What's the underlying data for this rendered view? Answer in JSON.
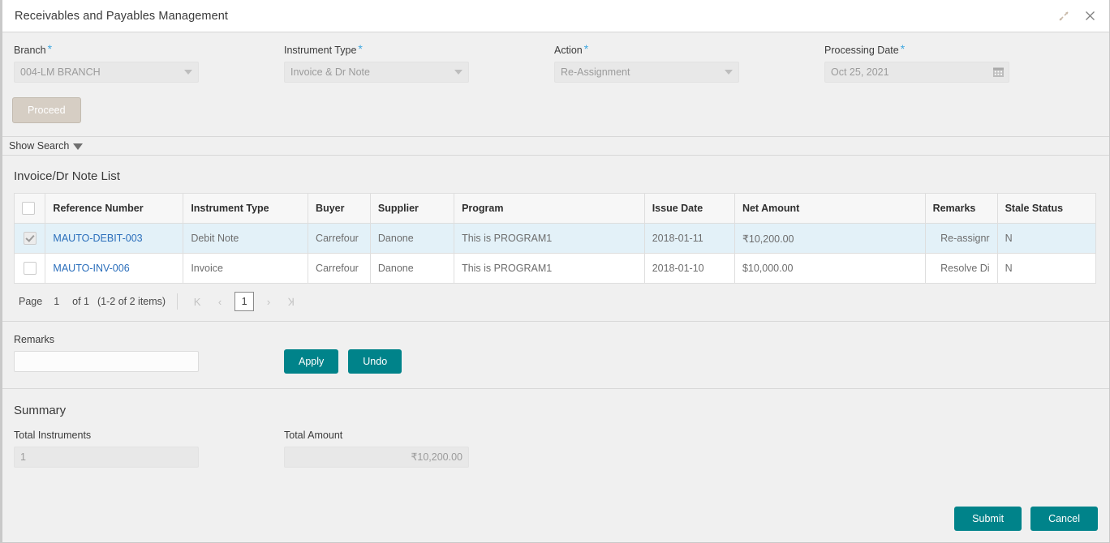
{
  "window": {
    "title": "Receivables and Payables Management",
    "controls": [
      {
        "name": "minimize-icon",
        "label": "minimize"
      },
      {
        "name": "close-icon",
        "label": "close"
      }
    ]
  },
  "form": {
    "fields": [
      {
        "label": "Branch",
        "required": "*",
        "value": "004-LM BRANCH",
        "type": "select",
        "name": "branch"
      },
      {
        "label": "Instrument Type",
        "required": "*",
        "value": "Invoice & Dr Note",
        "type": "select",
        "name": "instrument-type"
      },
      {
        "label": "Action",
        "required": "*",
        "value": "Re-Assignment",
        "type": "select",
        "name": "action"
      },
      {
        "label": "Processing Date",
        "required": "*",
        "value": "Oct 25, 2021",
        "type": "date",
        "name": "processing-date"
      }
    ],
    "proceed_label": "Proceed"
  },
  "search": {
    "toggle_label": "Show Search"
  },
  "list": {
    "title": "Invoice/Dr Note List",
    "columns": [
      "Reference Number",
      "Instrument Type",
      "Buyer",
      "Supplier",
      "Program",
      "Issue Date",
      "Net Amount",
      "Remarks",
      "Stale Status"
    ],
    "rows": [
      {
        "selected": true,
        "reference_number": "MAUTO-DEBIT-003",
        "instrument_type": "Debit Note",
        "buyer": "Carrefour",
        "supplier": "Danone",
        "program": "This is PROGRAM1",
        "issue_date": "2018-01-11",
        "net_amount": "₹10,200.00",
        "remarks": "Re-assignr",
        "stale_status": "N"
      },
      {
        "selected": false,
        "reference_number": "MAUTO-INV-006",
        "instrument_type": "Invoice",
        "buyer": "Carrefour",
        "supplier": "Danone",
        "program": "This is PROGRAM1",
        "issue_date": "2018-01-10",
        "net_amount": "$10,000.00",
        "remarks": "Resolve Di",
        "stale_status": "N"
      }
    ],
    "pagination": {
      "page_label": "Page",
      "page_number": "1",
      "of_label": "of 1",
      "items_label": "(1-2 of 2 items)",
      "first_icon": "K",
      "prev_icon": "‹",
      "current_page": "1",
      "next_icon": "›",
      "last_icon": "Ʞ"
    }
  },
  "remarks_section": {
    "label": "Remarks",
    "value": "",
    "placeholder": "",
    "apply_label": "Apply",
    "undo_label": "Undo"
  },
  "summary": {
    "title": "Summary",
    "total_instruments_label": "Total Instruments",
    "total_instruments_value": "1",
    "total_amount_label": "Total Amount",
    "total_amount_value": "₹10,200.00"
  },
  "footer": {
    "submit_label": "Submit",
    "cancel_label": "Cancel"
  },
  "colors": {
    "teal": "#00838a",
    "link": "#2a6ebb",
    "selected_row": "#e3f1f8",
    "required_star": "#3ea7e0",
    "proceed_disabled": "#d6cec4"
  }
}
